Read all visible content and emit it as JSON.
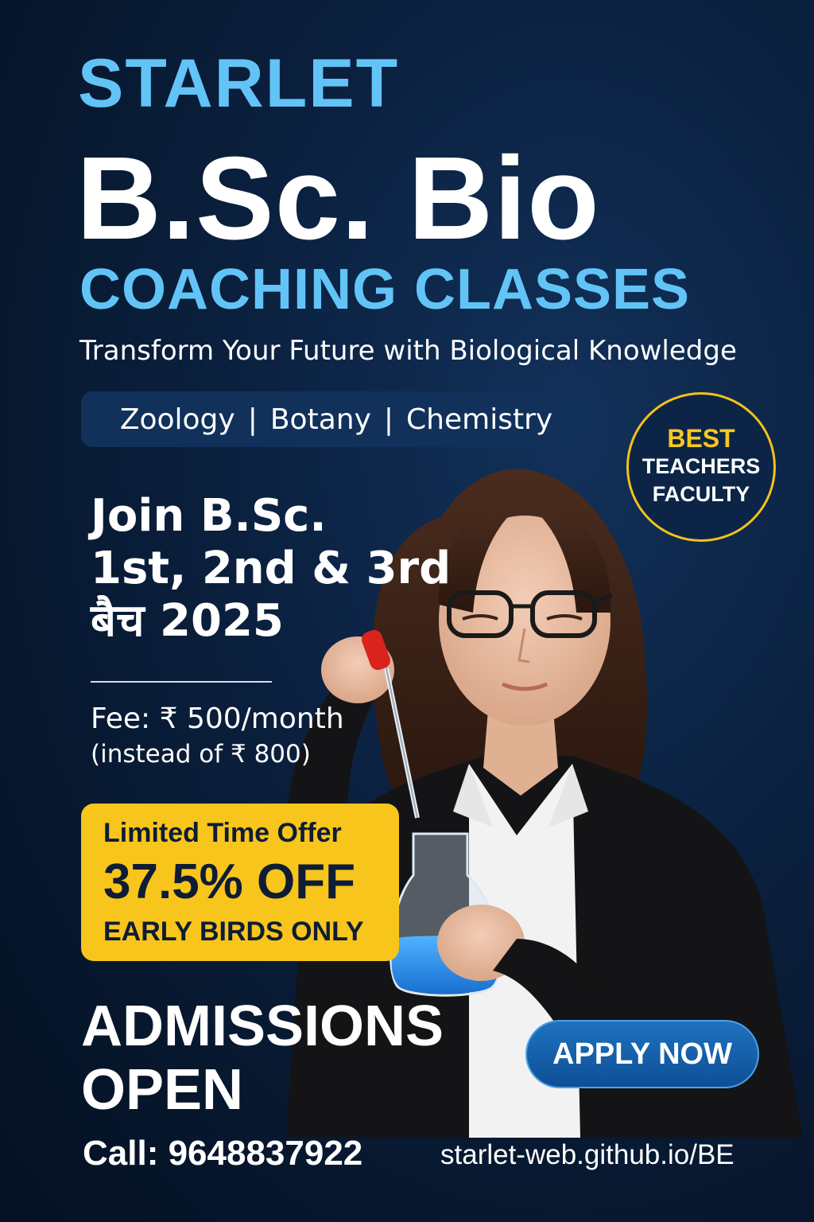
{
  "brand": "STARLET",
  "course": "B.Sc. Bio",
  "classes": "COACHING CLASSES",
  "tagline": "Transform Your Future with Biological Knowledge",
  "subjects": [
    "Zoology",
    "Botany",
    "Chemistry"
  ],
  "subject_separator": "|",
  "badge": {
    "line1": "BEST",
    "line2": "TEACHERS",
    "line3": "FACULTY"
  },
  "join": {
    "line1": "Join B.Sc.",
    "line2": "1st, 2nd & 3rd",
    "line3": "बैच 2025"
  },
  "fee": {
    "current": "Fee: ₹ 500/month",
    "original": "(instead of ₹ 800)"
  },
  "offer": {
    "label": "Limited Time Offer",
    "discount": "37.5% OFF",
    "note": "EARLY BIRDS ONLY"
  },
  "admissions": {
    "line1": "ADMISSIONS",
    "line2": "OPEN"
  },
  "cta": "APPLY NOW",
  "contact": {
    "call": "Call: 9648837922",
    "url": "starlet-web.github.io/BE"
  },
  "colors": {
    "background": "#07172d",
    "accent_blue": "#62c4f6",
    "offer_yellow": "#f7c51b",
    "badge_border": "#f2c21a",
    "button_blue": "#1e72c0"
  },
  "icons": {
    "photo": "scientist-with-flask-illustration"
  }
}
